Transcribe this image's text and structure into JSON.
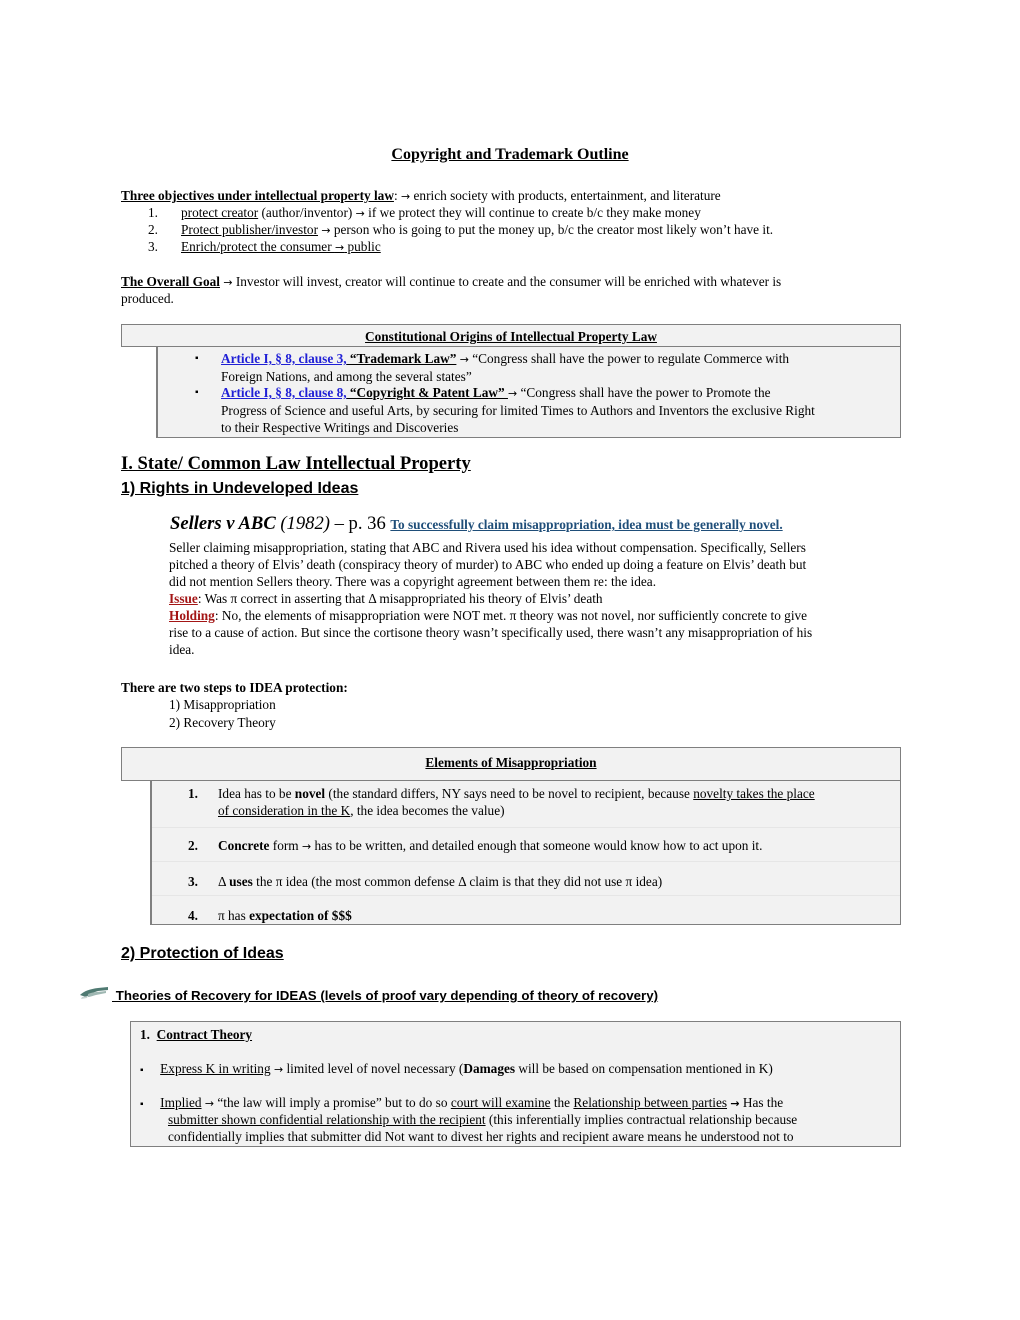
{
  "title": "Copyright and Trademark Outline",
  "objectives": {
    "heading": "Three objectives under intellectual property law",
    "summary": "enrich society with products, entertainment, and literature",
    "items": [
      {
        "num": "1.",
        "label": "protect creator",
        "rest": " (author/inventor) ",
        "after": " if we protect they will continue to create b/c they make money"
      },
      {
        "num": "2.",
        "label": "Protect publisher/investor",
        "rest": " ",
        "after": " person who is going to put the money up, b/c the creator most likely won’t have it."
      },
      {
        "num": "3.",
        "label": "Enrich/protect the consumer ",
        "rest": "",
        "after": " public"
      }
    ]
  },
  "overall_goal": {
    "label": "The Overall Goal",
    "text_line1": " Investor will invest, creator will continue to create and the consumer will be enriched with whatever is",
    "text_line2": "produced."
  },
  "constitutional": {
    "heading": "Constitutional Origins of Intellectual Property Law",
    "items": [
      {
        "link": "Article I, § 8, clause 3,",
        "name": " “Trademark Law”",
        "quote_line1": " “Congress shall have the power to regulate Commerce with",
        "quote_rest": [
          "Foreign Nations, and among the several states”"
        ]
      },
      {
        "link": "Article I, § 8, clause 8,",
        "name": " “Copyright & Patent Law” ",
        "quote_line1": " “Congress shall have the power to Promote the",
        "quote_rest": [
          "Progress of Science and useful Arts, by securing for limited Times to Authors and Inventors the exclusive Right",
          "to their Respective Writings and Discoveries"
        ]
      }
    ]
  },
  "section1": {
    "heading": "I. State/ Common Law Intellectual Property",
    "sub1": "1) Rights in Undeveloped Ideas"
  },
  "case": {
    "name": "Sellers v ABC",
    "year": " (1982)",
    "page": " – p. 36 ",
    "rule": "To successfully claim misappropriation, idea must be generally novel. ",
    "facts": [
      "Seller claiming misappropriation, stating that ABC and Rivera used his idea without compensation. Specifically, Sellers",
      "pitched a theory of Elvis’ death (conspiracy theory of murder) to ABC who ended up doing a feature on Elvis’ death but",
      "did not mention Sellers theory.  There was a copyright agreement between them re: the idea."
    ],
    "issue_label": "Issue",
    "issue_text": ": Was π correct in asserting that Δ misappropriated his theory of Elvis’ death",
    "holding_label": "Holding",
    "holding_lines": [
      ": No, the elements of misappropriation were NOT met. π theory was not novel, nor sufficiently concrete to give",
      "rise to a cause of action.  But since the cortisone theory wasn’t specifically used, there wasn’t any misappropriation of his",
      "idea."
    ]
  },
  "two_steps": {
    "heading": "There are two steps to IDEA protection:",
    "items": [
      "1) Misappropriation",
      "2) Recovery Theory"
    ]
  },
  "elements": {
    "heading": "Elements of Misappropriation",
    "items": [
      {
        "num": "1.",
        "pre": "Idea has to be ",
        "bold": "novel",
        "post": " (the standard differs, NY says need to be novel to recipient, because ",
        "underlined": "novelty takes the place",
        "line2_u": "of consideration in the K",
        "line2_rest": ", the idea becomes the value)"
      },
      {
        "num": "2.",
        "bold": "Concrete",
        "post": " form ",
        "after": " has to be written, and detailed enough that someone would know how to act upon it."
      },
      {
        "num": "3.",
        "pre": "Δ ",
        "bold": "uses",
        "post": " the π idea (the most common defense Δ claim is that they did not use π idea)"
      },
      {
        "num": "4.",
        "pre": "π has ",
        "bold": "expectation of $$$"
      }
    ]
  },
  "section2": {
    "heading": "2) Protection of Ideas",
    "theories_heading": " Theories of Recovery for IDEAS (levels of proof vary depending of theory of recovery)"
  },
  "theories": {
    "item1_num": "1.",
    "item1_label": "Contract Theory",
    "express_label": "Express K in writing",
    "express_text": " limited level of novel necessary (",
    "express_bold": "Damages",
    "express_end": " will be based on compensation mentioned in K)",
    "implied_label": "Implied",
    "implied_text1": " “the law will imply a promise” but to do so ",
    "implied_u1": "court will examine",
    "implied_text2": " the ",
    "implied_u2": "Relationship between parties",
    "implied_text3": " Has the",
    "implied_line2_u": "submitter shown confidential relationship with the recipient",
    "implied_line2_rest": " (this inferentially implies contractual relationship because",
    "implied_line3": "confidentially implies that submitter did Not want to divest her rights and recipient aware means he understood not to"
  },
  "symbols": {
    "arrow": "→",
    "bullet": "▪"
  }
}
